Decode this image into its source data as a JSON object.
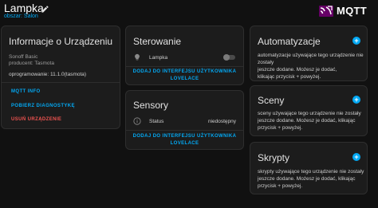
{
  "header": {
    "title": "Lampka",
    "subtitle": "obszar: Salon",
    "brand": "MQTT"
  },
  "device_info": {
    "title": "Informacje o Urządzeniu",
    "model": "Sonoff Basic",
    "manufacturer": "producent: Tasmota",
    "firmware": "oprogramowanie: 11.1.0(tasmota)",
    "mqtt_info": "MQTT INFO",
    "diagnostics": "POBIERZ DIAGNOSTYKĘ",
    "delete": "USUŃ URZĄDZENIE"
  },
  "controls": {
    "title": "Sterowanie",
    "entity_name": "Lampka",
    "toggle_state": "off",
    "add_line1": "DODAJ DO INTERFEJSU UŻYTKOWNIKA",
    "add_line2": "LOVELACE"
  },
  "sensors": {
    "title": "Sensory",
    "entity_name": "Status",
    "entity_value": "niedostępny",
    "add_line1": "DODAJ DO INTERFEJSU UŻYTKOWNIKA",
    "add_line2": "LOVELACE"
  },
  "automations": {
    "title": "Automatyzacje",
    "desc_line1": "automatyzacje używające tego urządzenie nie zostały",
    "desc_line2": "jeszcze dodane. Możesz je dodać,",
    "desc_line3": "klikając przycisk + powyżej."
  },
  "scenes": {
    "title": "Sceny",
    "desc_line1": "sceny używające tego urządzenie nie zostały",
    "desc_line2": "jeszcze dodane. Możesz je dodać, klikając",
    "desc_line3": "przycisk + powyżej."
  },
  "scripts": {
    "title": "Skrypty",
    "desc_line1": "skrypty używające tego urządzenie nie zostały",
    "desc_line2": "jeszcze dodane. Możesz je dodać, klikając",
    "desc_line3": "przycisk + powyżej."
  },
  "colors": {
    "accent": "#03a9f4",
    "danger": "#ef5350",
    "card": "#1c1c1c",
    "background": "#111111"
  },
  "icons": {
    "edit": "pencil-icon",
    "brand": "mqtt-logo-icon",
    "lamp": "lightbulb-icon",
    "info": "info-circle-icon",
    "add": "plus-circle-icon"
  }
}
